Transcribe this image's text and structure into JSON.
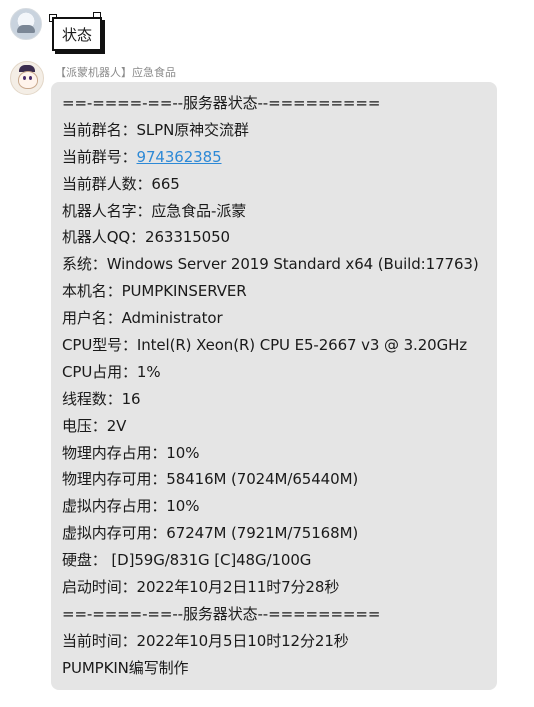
{
  "first_message": {
    "sticker_text": "状态"
  },
  "bot_message": {
    "sender": "【派蒙机器人】应急食品",
    "lines": {
      "l01": "==-====-==--服务器状态--=========",
      "l02": "当前群名：SLPN原神交流群",
      "l03_label": "当前群号：",
      "l03_value": "974362385",
      "l04": "当前群人数：665",
      "l05": "机器人名字：应急食品-派蒙",
      "l06": "机器人QQ：263315050",
      "l07": "系统：Windows Server 2019 Standard  x64 (Build:17763)",
      "l08": "本机名：PUMPKINSERVER",
      "l09": "用户名：Administrator",
      "l10": "CPU型号：Intel(R) Xeon(R) CPU E5-2667 v3 @ 3.20GHz",
      "l11": "CPU占用：1%",
      "l12": "线程数：16",
      "l13": "电压：2V",
      "l14": "物理内存占用：10%",
      "l15": "物理内存可用：58416M (7024M/65440M)",
      "l16": "虚拟内存占用：10%",
      "l17": "虚拟内存可用：67247M (7921M/75168M)",
      "l18": "硬盘：  [D]59G/831G [C]48G/100G",
      "l19": "启动时间：2022年10月2日11时7分28秒",
      "l20": "==-====-==--服务器状态--=========",
      "l21": "当前时间：2022年10月5日10时12分21秒",
      "l22": "PUMPKIN编写制作"
    }
  },
  "colors": {
    "bubble": "#e5e5e5",
    "link": "#2d89d6",
    "sender": "#8a8a8a"
  },
  "icons": {
    "user_avatar": "user-avatar",
    "bot_avatar": "paimon-avatar"
  }
}
